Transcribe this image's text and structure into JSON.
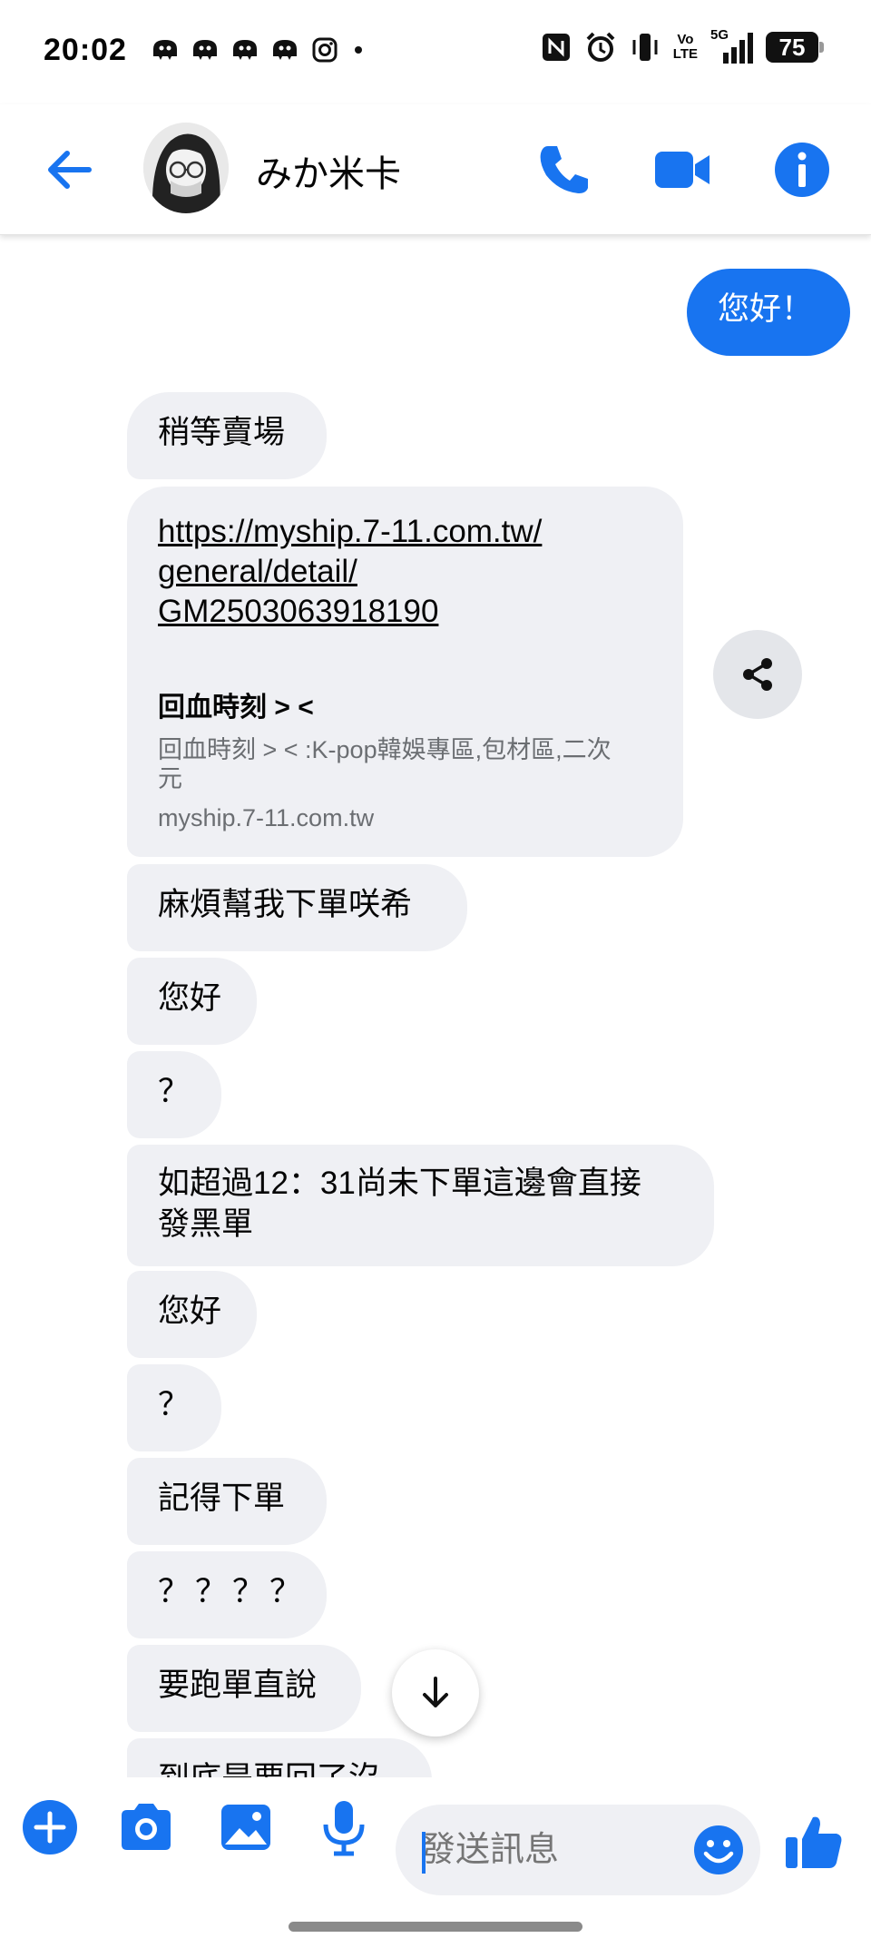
{
  "status_bar": {
    "time": "20:02",
    "left_icons": [
      "messenger-bot-icon",
      "messenger-bot-icon",
      "messenger-bot-icon",
      "messenger-bot-icon",
      "instagram-icon",
      "dot-icon"
    ],
    "volte_top": "Vo",
    "volte_bottom": "LTE",
    "network": "5G",
    "battery": "75"
  },
  "header": {
    "contact_name": "みか米卡"
  },
  "messages": {
    "m0": "您好！",
    "m1": "稍等賣場",
    "m2": "麻煩幫我下單咲希",
    "m3": "您好",
    "m4": "？",
    "m5_line1": "如超過12：31尚未下單這邊會直接",
    "m5_line2": "發黑單",
    "m6": "您好",
    "m7": "？",
    "m8": "記得下單",
    "m9": "？？？？",
    "m10": "要跑單直說",
    "m11": "到底是要回了沒"
  },
  "link_preview": {
    "url_line1": "https://myship.7-11.com.tw/",
    "url_line2": "general/detail/",
    "url_line3": "GM2503063918190",
    "title": "回血時刻 > <",
    "description": "回血時刻 > < :K-pop韓娛專區,包材區,二次元",
    "domain": "myship.7-11.com.tw"
  },
  "composer": {
    "placeholder": "發送訊息"
  },
  "colors": {
    "accent": "#1874f0",
    "bubble_gray": "#eff0f4"
  }
}
